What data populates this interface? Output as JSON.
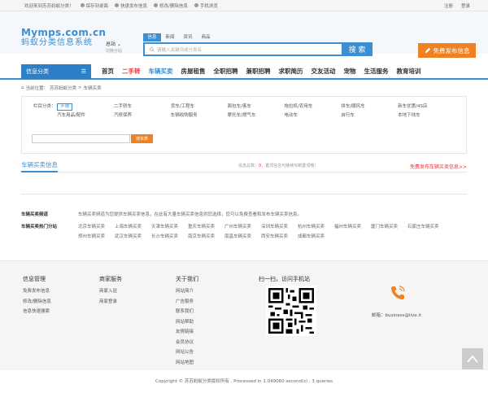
{
  "topbar": {
    "welcome": "欢迎来到苏苏蚂蚁分类！",
    "links": [
      "保存到桌面",
      "快速发布信息",
      "修改/删除信息",
      "手机浏览"
    ],
    "login": "注册",
    "register": "登录"
  },
  "logo": {
    "title": "Mymps.com.cn",
    "subtitle": "蚂蚁分类信息系统"
  },
  "city": {
    "name": "总站",
    "switch": "切换分站"
  },
  "search": {
    "tabs": [
      "信息",
      "新闻",
      "资讯",
      "商品"
    ],
    "placeholder": "请输入关键词或分类名",
    "button": "搜 索"
  },
  "post_button": "免费发布信息",
  "nav": {
    "category_label": "信息分类",
    "items": [
      "首页",
      "二手转",
      "车辆买卖",
      "房屋租售",
      "全职招聘",
      "兼职招聘",
      "求职简历",
      "交友活动",
      "宠物",
      "生活服务",
      "教育培训"
    ]
  },
  "breadcrumb": [
    "当前位置：",
    "苏苏蚂蚁分类",
    "车辆买卖"
  ],
  "filter": {
    "label": "栏目分类：",
    "unlimited": "不限",
    "row1": [
      "二手轿车",
      "货车/工程车",
      "面包车/客车",
      "拖拉机/农用车",
      "拼车/顺风车",
      "新车优惠/4S店"
    ],
    "row2": [
      "汽车用品/配件",
      "汽修保养",
      "车辆收购服务",
      "摩托车/燃气车",
      "电动车",
      "自行车",
      "本地下线车"
    ],
    "search_button": "搜本类"
  },
  "list": {
    "title": "车辆买卖信息",
    "count_prefix": "信息总数：",
    "count": "0",
    "count_suffix": "，置顶信息可继续买断置顶哦！",
    "post_link": "免费发布车辆买卖信息>>"
  },
  "desc": {
    "channel_label": "车辆买卖频道",
    "channel_text": "车辆买卖频道为您提供车辆买卖信息，在此有大量车辆买卖信息供您选择，您可以免费查看和发布车辆买卖信息。",
    "cities_label": "车辆买卖热门分站",
    "cities": [
      "北京车辆买卖",
      "上海车辆买卖",
      "天津车辆买卖",
      "重庆车辆买卖",
      "广州车辆买卖",
      "深圳车辆买卖",
      "杭州车辆买卖",
      "福州车辆买卖",
      "厦门车辆买卖",
      "石家庄车辆买卖",
      "郑州车辆买卖",
      "武汉车辆买卖",
      "长沙车辆买卖",
      "南京车辆买卖",
      "南昌车辆买卖",
      "西安车辆买卖",
      "成都车辆买卖"
    ]
  },
  "footer": {
    "col1": {
      "title": "信息管理",
      "items": [
        "免费发布信息",
        "修改/删除信息",
        "信息快速搜索"
      ]
    },
    "col2": {
      "title": "商家服务",
      "items": [
        "商家入驻",
        "商家登录"
      ]
    },
    "col3": {
      "title": "关于我们",
      "items": [
        "网站简介",
        "广告服务",
        "联系我们",
        "网站帮助",
        "友情链接",
        "会员协议",
        "网站公告",
        "网站地图"
      ]
    },
    "qr_title": "扫一扫，访问手机站",
    "email": "邮箱：business@live.it"
  },
  "copyright": "Copyright © 苏苏蚂蚁分类版权所有 , Processed in 1.049060 second(s) , 3 queries"
}
